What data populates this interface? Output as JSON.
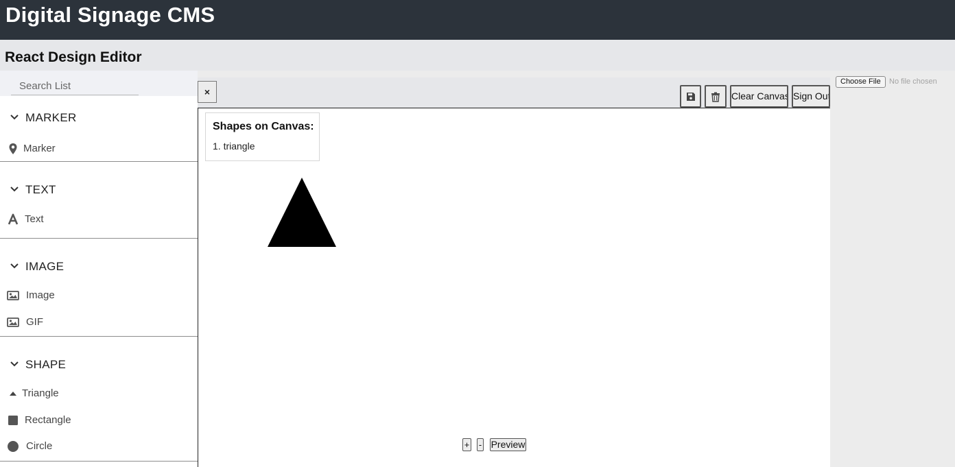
{
  "app": {
    "title": "Digital Signage CMS",
    "subtitle": "React Design Editor"
  },
  "sidebar": {
    "search_placeholder": "Search List",
    "groups": [
      {
        "title": "MARKER",
        "items": [
          {
            "label": "Marker",
            "icon": "map-pin-icon"
          }
        ]
      },
      {
        "title": "TEXT",
        "items": [
          {
            "label": "Text",
            "icon": "letter-a-icon"
          }
        ]
      },
      {
        "title": "IMAGE",
        "items": [
          {
            "label": "Image",
            "icon": "image-icon"
          },
          {
            "label": "GIF",
            "icon": "image-icon"
          }
        ]
      },
      {
        "title": "SHAPE",
        "items": [
          {
            "label": "Triangle",
            "icon": "triangle-icon"
          },
          {
            "label": "Rectangle",
            "icon": "square-icon"
          },
          {
            "label": "Circle",
            "icon": "circle-icon"
          }
        ]
      }
    ]
  },
  "toolbar": {
    "close_label": "×",
    "save_icon": "save-icon",
    "delete_icon": "trash-icon",
    "clear_canvas_label": "Clear Canvas",
    "sign_out_label": "Sign Out"
  },
  "canvas": {
    "shapes_title": "Shapes on Canvas:",
    "shapes": [
      "1. triangle"
    ],
    "zoom_in_label": "+",
    "zoom_out_label": "-",
    "preview_label": "Preview"
  },
  "file_input": {
    "button_label": "Choose File",
    "status": "No file chosen"
  },
  "colors": {
    "header_bg": "#2c333b",
    "subheader_bg": "#e6e7ea",
    "shape_fill": "#000000"
  }
}
